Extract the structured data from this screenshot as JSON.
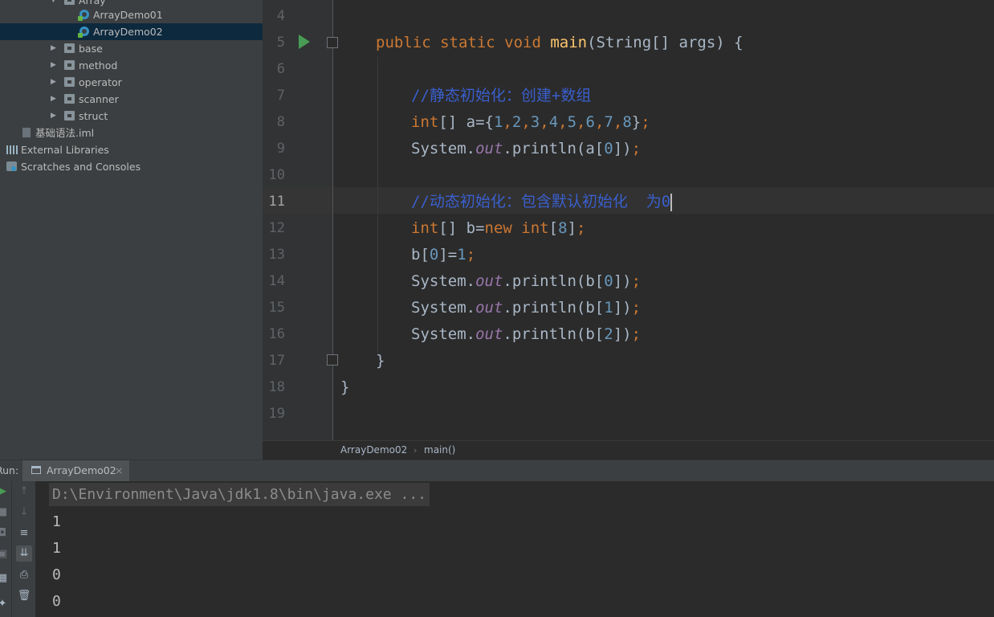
{
  "project_tree": {
    "items": [
      {
        "label": "Array",
        "icon": "folder-icon",
        "expanded": true
      },
      {
        "label": "ArrayDemo01",
        "icon": "java-class-icon"
      },
      {
        "label": "ArrayDemo02",
        "icon": "java-class-icon",
        "selected": true
      },
      {
        "label": "base",
        "icon": "folder-icon"
      },
      {
        "label": "method",
        "icon": "folder-icon"
      },
      {
        "label": "operator",
        "icon": "folder-icon"
      },
      {
        "label": "scanner",
        "icon": "folder-icon"
      },
      {
        "label": "struct",
        "icon": "folder-icon"
      },
      {
        "label": "基础语法.iml",
        "icon": "iml-file-icon"
      },
      {
        "label": "External Libraries",
        "icon": "library-icon"
      },
      {
        "label": "Scratches and Consoles",
        "icon": "scratches-icon"
      }
    ]
  },
  "editor": {
    "current_line": "11",
    "line_numbers": [
      "4",
      "5",
      "6",
      "7",
      "8",
      "9",
      "10",
      "11",
      "12",
      "13",
      "14",
      "15",
      "16",
      "17",
      "18",
      "19"
    ],
    "code": {
      "l5": {
        "kw1": "public static void ",
        "fn": "main",
        "rest": "(String[] args) {"
      },
      "l7": {
        "comment": "//静态初始化：创建+数组"
      },
      "l8": {
        "kw": "int",
        "t1": "[] a={",
        "n1": "1",
        "c1": ",",
        "n2": "2",
        "c2": ",",
        "n3": "3",
        "c3": ",",
        "n4": "4",
        "c4": ",",
        "n5": "5",
        "c5": ",",
        "n6": "6",
        "c6": ",",
        "n7": "7",
        "c7": ",",
        "n8": "8",
        "t2": "}",
        "semi": ";"
      },
      "l9": {
        "t1": "System.",
        "field": "out",
        "t2": ".println(a[",
        "n": "0",
        "t3": "])",
        "semi": ";"
      },
      "l11": {
        "comment": "//动态初始化：包含默认初始化  为0"
      },
      "l12": {
        "kw": "int",
        "t1": "[] b=",
        "kw2": "new int",
        "t2": "[",
        "n": "8",
        "t3": "]",
        "semi": ";"
      },
      "l13": {
        "t1": "b[",
        "n1": "0",
        "t2": "]=",
        "n2": "1",
        "semi": ";"
      },
      "l14": {
        "t1": "System.",
        "field": "out",
        "t2": ".println(b[",
        "n": "0",
        "t3": "])",
        "semi": ";"
      },
      "l15": {
        "t1": "System.",
        "field": "out",
        "t2": ".println(b[",
        "n": "1",
        "t3": "])",
        "semi": ";"
      },
      "l16": {
        "t1": "System.",
        "field": "out",
        "t2": ".println(b[",
        "n": "2",
        "t3": "])",
        "semi": ";"
      },
      "l17": {
        "t": "}"
      },
      "l18": {
        "t": "}"
      }
    }
  },
  "breadcrumb": {
    "class": "ArrayDemo02",
    "method": "main()"
  },
  "run_panel": {
    "label": "Run:",
    "tab_label": "ArrayDemo02",
    "close": "×",
    "command": "D:\\Environment\\Java\\jdk1.8\\bin\\java.exe ...",
    "output": [
      "1",
      "1",
      "0",
      "0"
    ]
  },
  "colors": {
    "keyword": "#cc7832",
    "method_decl": "#ffc66d",
    "number": "#6897bb",
    "comment": "#3a5fcd",
    "static_field": "#9876aa",
    "selection": "#0d293e",
    "run_green": "#499c54"
  }
}
